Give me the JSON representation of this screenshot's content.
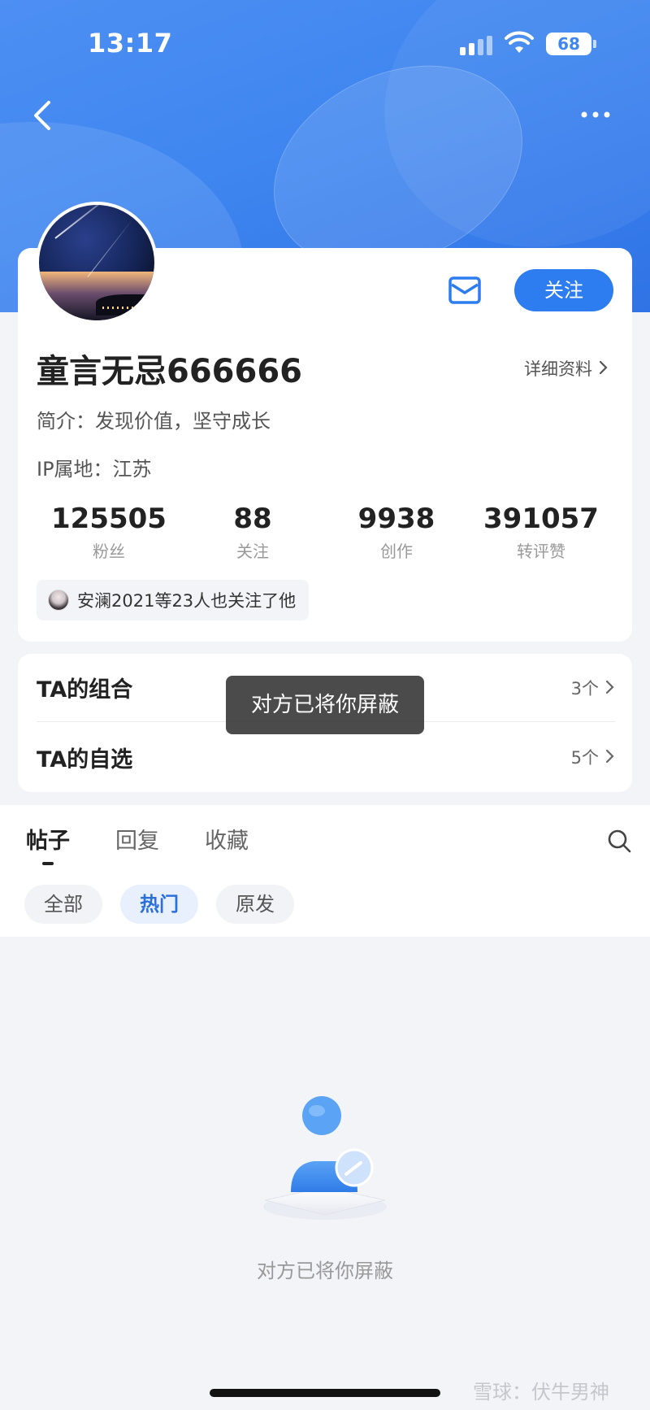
{
  "status_bar": {
    "time": "13:17",
    "battery": "68"
  },
  "profile": {
    "nickname": "童言无忌666666",
    "detail_link": "详细资料",
    "bio": "简介：发现价值，坚守成长",
    "ip_location": "IP属地：江苏",
    "follow_button": "关注",
    "stats": [
      {
        "value": "125505",
        "label": "粉丝"
      },
      {
        "value": "88",
        "label": "关注"
      },
      {
        "value": "9938",
        "label": "创作"
      },
      {
        "value": "391057",
        "label": "转评赞"
      }
    ],
    "mutual_follow": "安澜2021等23人也关注了他"
  },
  "lists": [
    {
      "title": "TA的组合",
      "count": "3个"
    },
    {
      "title": "TA的自选",
      "count": "5个"
    }
  ],
  "toast": "对方已将你屏蔽",
  "tabs": [
    {
      "label": "帖子",
      "active": true
    },
    {
      "label": "回复",
      "active": false
    },
    {
      "label": "收藏",
      "active": false
    }
  ],
  "filters": [
    {
      "label": "全部",
      "active": false
    },
    {
      "label": "热门",
      "active": true
    },
    {
      "label": "原发",
      "active": false
    }
  ],
  "empty_state": {
    "message": "对方已将你屏蔽"
  },
  "watermark": "雪球：伏牛男神",
  "colors": {
    "accent": "#2d7df0",
    "header": "#3f86f0"
  },
  "icons": [
    "back-icon",
    "more-icon",
    "mail-icon",
    "search-icon",
    "blocked-user-icon",
    "chevron-right-icon"
  ]
}
